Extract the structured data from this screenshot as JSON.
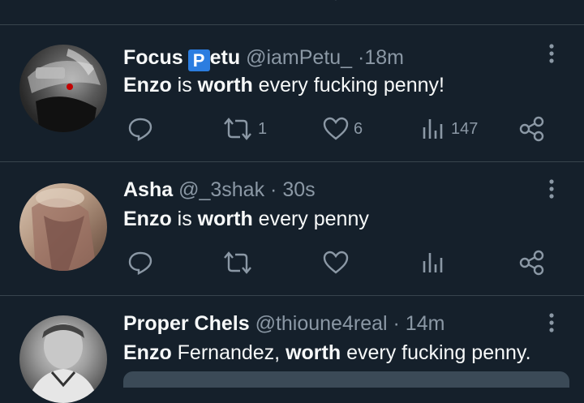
{
  "timeline": {
    "tweets": [
      {
        "name": "Focus",
        "badge": "P",
        "name_suffix": "etu",
        "handle": "@iamPetu_",
        "separator": "·",
        "time": "18m",
        "text_parts": [
          "Enzo",
          " is ",
          "worth",
          " every fucking penny!"
        ],
        "retweets": "1",
        "likes": "6",
        "views": "147"
      },
      {
        "name": "Asha",
        "handle": "@_3shak",
        "separator": "·",
        "time": "30s",
        "text_parts": [
          "Enzo",
          " is ",
          "worth",
          " every penny"
        ],
        "retweets": "",
        "likes": "",
        "views": ""
      },
      {
        "name": "Proper Chels",
        "handle": "@thioune4real",
        "separator": "·",
        "time": "14m",
        "text_parts": [
          "Enzo",
          " Fernandez, ",
          "worth",
          " every fucking penny."
        ]
      }
    ]
  },
  "colors": {
    "background": "#15202b",
    "text_primary": "#f7f9f9",
    "text_secondary": "#8b98a5",
    "divider": "#38444d",
    "badge": "#2b7de0"
  },
  "icons": [
    "reply-icon",
    "retweet-icon",
    "like-icon",
    "views-icon",
    "share-icon",
    "more-icon"
  ]
}
